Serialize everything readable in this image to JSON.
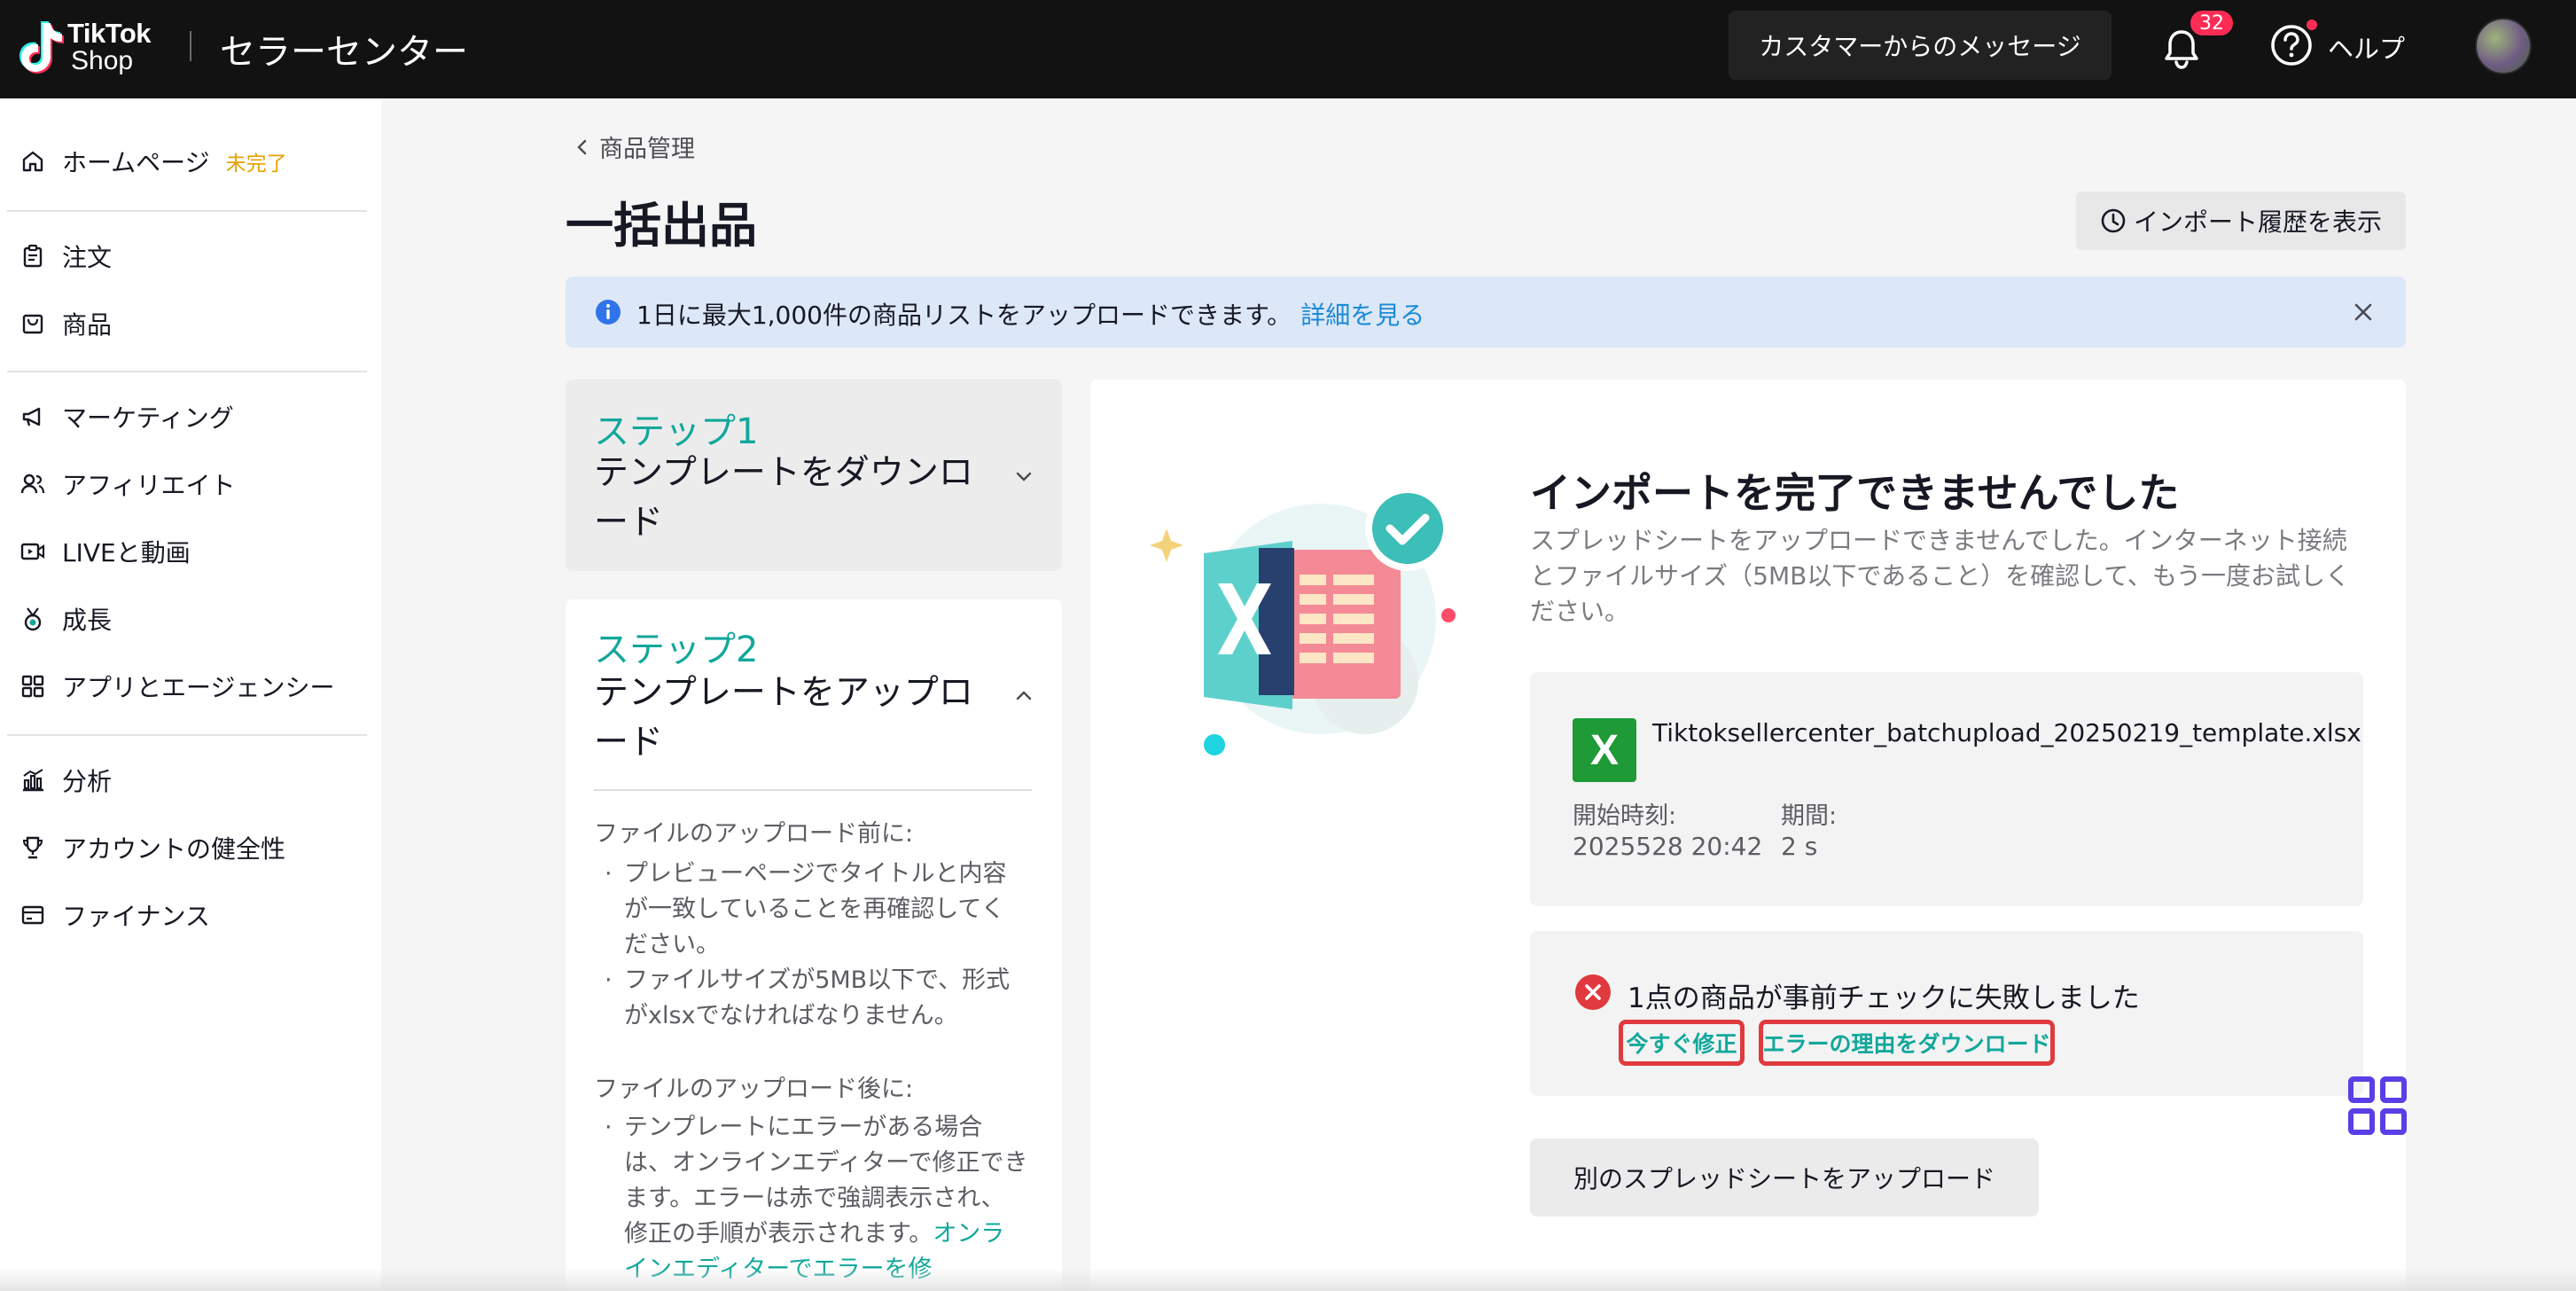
{
  "header": {
    "logo": {
      "word1": "TikTok",
      "word2": "Shop"
    },
    "app_title": "セラーセンター",
    "customer_messages": "カスタマーからのメッセージ",
    "notification_count": "32",
    "help_label": "ヘルプ"
  },
  "sidebar": {
    "home": {
      "label": "ホームページ",
      "badge": "未完了"
    },
    "items": [
      {
        "label": "注文",
        "icon": "clipboard-icon"
      },
      {
        "label": "商品",
        "icon": "bag-icon"
      },
      {
        "label": "マーケティング",
        "icon": "megaphone-icon"
      },
      {
        "label": "アフィリエイト",
        "icon": "people-icon"
      },
      {
        "label": "LIVEと動画",
        "icon": "video-icon"
      },
      {
        "label": "成長",
        "icon": "medal-icon"
      },
      {
        "label": "アプリとエージェンシー",
        "icon": "apps-icon"
      },
      {
        "label": "分析",
        "icon": "chart-icon"
      },
      {
        "label": "アカウントの健全性",
        "icon": "trophy-icon"
      },
      {
        "label": "ファイナンス",
        "icon": "wallet-icon"
      }
    ]
  },
  "main": {
    "breadcrumb": "商品管理",
    "title": "一括出品",
    "history_button": "インポート履歴を表示",
    "banner": {
      "text": "1日に最大1,000件の商品リストをアップロードできます。",
      "link": "詳細を見る"
    },
    "step1": {
      "number": "ステップ1",
      "title": "テンプレートをダウンロード"
    },
    "step2": {
      "number": "ステップ2",
      "title": "テンプレートをアップロード",
      "before_heading": "ファイルのアップロード前に:",
      "before_items": [
        "プレビューページでタイトルと内容が一致していることを再確認してください。",
        "ファイルサイズが5MB以下で、形式がxlsxでなければなりません。"
      ],
      "after_heading": "ファイルのアップロード後に:",
      "after_item": "テンプレートにエラーがある場合は、オンラインエディターで修正できます。エラーは赤で強調表示され、修正の手順が表示されます。",
      "after_link": "オンラインエディターでエラーを修"
    },
    "result": {
      "title": "インポートを完了できませんでした",
      "description": "スプレッドシートをアップロードできませんでした。インターネット接続とファイルサイズ（5MB以下であること）を確認して、もう一度お試しください。",
      "file_icon": "X",
      "file_name": "Tiktoksellercenter_batchupload_20250219_template.xlsx",
      "start_label": "開始時刻:",
      "start_value": "2025528 20:42",
      "duration_label": "期間:",
      "duration_value": "2 s",
      "error_text": "1点の商品が事前チェックに失敗しました",
      "fix_now": "今すぐ修正",
      "download_reasons": "エラーの理由をダウンロード",
      "upload_another": "別のスプレッドシートをアップロード"
    }
  },
  "colors": {
    "accent": "#12a79b",
    "error": "#e03a3e",
    "link": "#1b8bd6",
    "badge": "#fe2c55"
  }
}
